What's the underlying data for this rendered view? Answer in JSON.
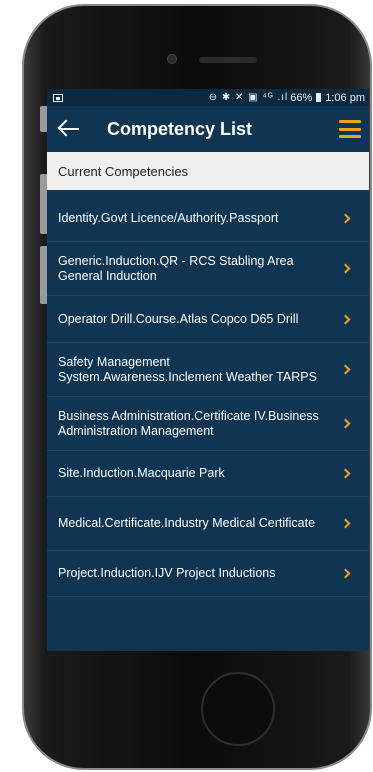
{
  "statusbar": {
    "icons": "⊖ ✱ ✕ ▣ ⁴ᴳ .ıl",
    "battery": "66%",
    "time": "1:06 pm"
  },
  "appbar": {
    "title": "Competency List",
    "back_icon": "arrow-left",
    "menu_icon": "hamburger"
  },
  "section": {
    "header": "Current Competencies"
  },
  "colors": {
    "primary": "#0f3552",
    "accent": "#f0a21e",
    "section_bg": "#efefef"
  },
  "competencies": [
    {
      "label": "Identity.Govt Licence/Authority.Passport"
    },
    {
      "label": "Generic.Induction.QR - RCS Stabling Area General Induction"
    },
    {
      "label": "Operator Drill.Course.Atlas Copco D65 Drill"
    },
    {
      "label": "Safety Management System.Awareness.Inclement Weather TARPS"
    },
    {
      "label": "Business Administration.Certificate IV.Business Administration Management"
    },
    {
      "label": "Site.Induction.Macquarie Park"
    },
    {
      "label": "Medical.Certificate.Industry Medical Certificate"
    },
    {
      "label": "Project.Induction.IJV Project Inductions"
    }
  ]
}
